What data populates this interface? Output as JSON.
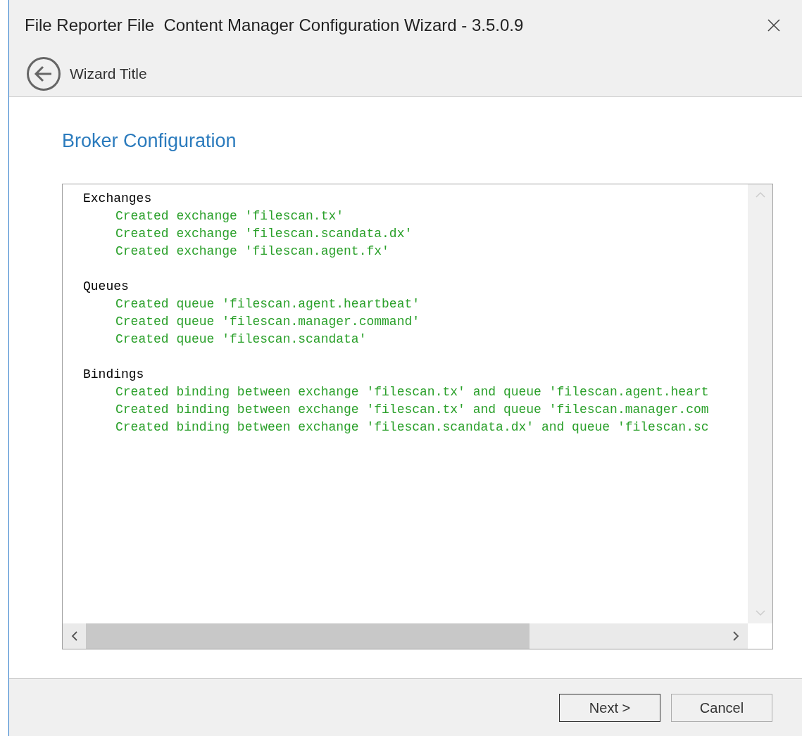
{
  "window": {
    "title": "File Reporter File  Content Manager Configuration Wizard - 3.5.0.9"
  },
  "nav": {
    "title": "Wizard Title"
  },
  "page_title": "Broker Configuration",
  "log": [
    {
      "heading": "Exchanges",
      "entries": [
        "Created exchange 'filescan.tx'",
        "Created exchange 'filescan.scandata.dx'",
        "Created exchange 'filescan.agent.fx'"
      ]
    },
    {
      "heading": "Queues",
      "entries": [
        "Created queue 'filescan.agent.heartbeat'",
        "Created queue 'filescan.manager.command'",
        "Created queue 'filescan.scandata'"
      ]
    },
    {
      "heading": "Bindings",
      "entries": [
        "Created binding between exchange 'filescan.tx' and queue 'filescan.agent.heart",
        "Created binding between exchange 'filescan.tx' and queue 'filescan.manager.com",
        "Created binding between exchange 'filescan.scandata.dx' and queue 'filescan.sc"
      ]
    }
  ],
  "buttons": [
    {
      "label": "Next >",
      "kind": "default"
    },
    {
      "label": "Cancel",
      "kind": "normal"
    }
  ]
}
